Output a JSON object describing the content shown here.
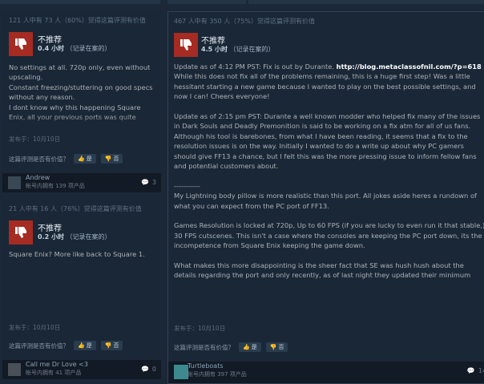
{
  "reviews": [
    {
      "helpful_text": "121 人中有 73 人（60%）觉得这篇评测有价值",
      "verdict": "不推荐",
      "hours_value": "0.4 小时",
      "hours_note": "（记录在案的）",
      "paragraphs": [
        "No settings at all. 720p only, even without upscaling.",
        "Constant freezing/stuttering on good specs without any reason.",
        "I dont know why this happening Square Enix, all your previous ports was quite"
      ],
      "posted": "发布于：10月10日",
      "question": "这篇评测是否有价值？",
      "yes_label": "是",
      "no_label": "否",
      "author_name": "Andrew",
      "author_products": "帐号内拥有 139 项产品",
      "comments": "3"
    },
    {
      "helpful_text": "21 人中有 16 人（76%）觉得这篇评测有价值",
      "verdict": "不推荐",
      "hours_value": "0.2 小时",
      "hours_note": "（记录在案的）",
      "paragraphs": [
        "Square Enix? More like back to Square 1."
      ],
      "posted": "发布于：10月10日",
      "question": "这篇评测是否有价值？",
      "yes_label": "是",
      "no_label": "否",
      "author_name": "Call me Dr Love <3",
      "author_products": "帐号内拥有 41 项产品",
      "comments": "0"
    },
    {
      "helpful_text": "467 人中有 350 人（75%）觉得这篇评测有价值",
      "verdict": "不推荐",
      "hours_value": "4.5 小时",
      "hours_note": "（记录在案的）",
      "update_lead": "Update as of 4:12 PM PST: Fix is out by Durante. ",
      "update_link": "http://blog.metaclassofnil.com/?p=618",
      "update_rest": " While this does not fix all of the problems remaining, this is a huge first step! Was a little hessitant starting a new game because I wanted to play on the best possible settings, and now I can! Cheers everyone!",
      "paragraphs": [
        "Update as of 2:15 pm PST: Durante a well known modder who helped fix many of the issues in Dark Souls and Deadly Premonition is said to be working on a fix atm for all of us fans. Although his tool is barebones, from what I have been reading, it seems that a fix to the resolution issues is on the way. Initially I wanted to do a write up about why PC gamers should give FF13 a chance, but I felt this was the more pressing issue to inform fellow fans and potential customers about.",
        "-----------",
        "My Lightning body pillow is more realistic than this port. All jokes aside heres a rundown of what you can expect from the PC port of FF13.",
        "Games Resolution is locked at 720p, Up to 60 FPS (if you are lucky to even run it that stable,) 30 FPS cutscenes. This isn't a case where the consoles are keeping the PC port down, its the incompetence from Square Enix keeping the game down.",
        "What makes this more disappointing is the sheer fact that SE was hush hush about the details regarding the port and only recently, as of last night they updated their minimum"
      ],
      "posted": "发布于：10月10日",
      "question": "这篇评测是否有价值？",
      "yes_label": "是",
      "no_label": "否",
      "author_name": "Turtleboats",
      "author_products": "帐号内拥有 397 项产品",
      "comments": "14"
    }
  ],
  "colors": {
    "thumb_down": "#a52b23",
    "background": "#1b2838",
    "card": "#1a2736"
  }
}
